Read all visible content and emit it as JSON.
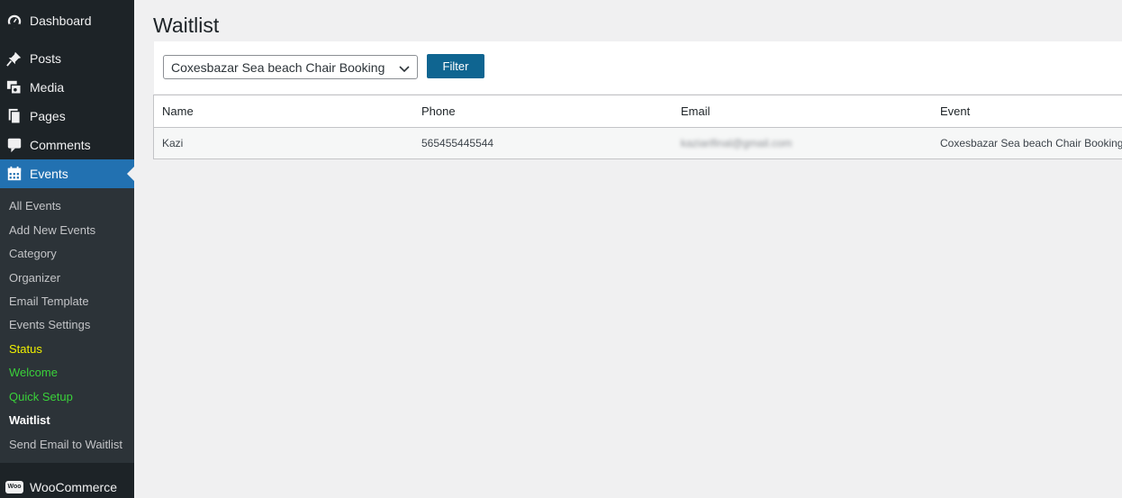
{
  "sidebar": {
    "menu": [
      {
        "label": "Dashboard",
        "icon": "dashboard-icon"
      },
      {
        "label": "Posts",
        "icon": "pushpin-icon"
      },
      {
        "label": "Media",
        "icon": "media-icon"
      },
      {
        "label": "Pages",
        "icon": "pages-icon"
      },
      {
        "label": "Comments",
        "icon": "comments-icon"
      },
      {
        "label": "Events",
        "icon": "calendar-icon"
      }
    ],
    "submenu": [
      "All Events",
      "Add New Events",
      "Category",
      "Organizer",
      "Email Template",
      "Events Settings",
      "Status",
      "Welcome",
      "Quick Setup",
      "Waitlist",
      "Send Email to Waitlist"
    ],
    "bottom_item": {
      "label": "WooCommerce",
      "icon": "woocommerce-icon",
      "icon_text": "Woo"
    }
  },
  "main": {
    "title": "Waitlist",
    "filter": {
      "selected_event": "Coxesbazar Sea beach Chair Booking",
      "button_label": "Filter"
    },
    "table": {
      "headers": [
        "Name",
        "Phone",
        "Email",
        "Event"
      ],
      "rows": [
        [
          "Kazi",
          "565455445544",
          "kaziarifinal@gmail.com",
          "Coxesbazar Sea beach Chair Booking"
        ]
      ]
    }
  },
  "colors": {
    "sidebar_bg": "#1d2327",
    "active_bg": "#2271b1",
    "button_bg": "#0f6591",
    "page_bg": "#f0f0f1"
  }
}
